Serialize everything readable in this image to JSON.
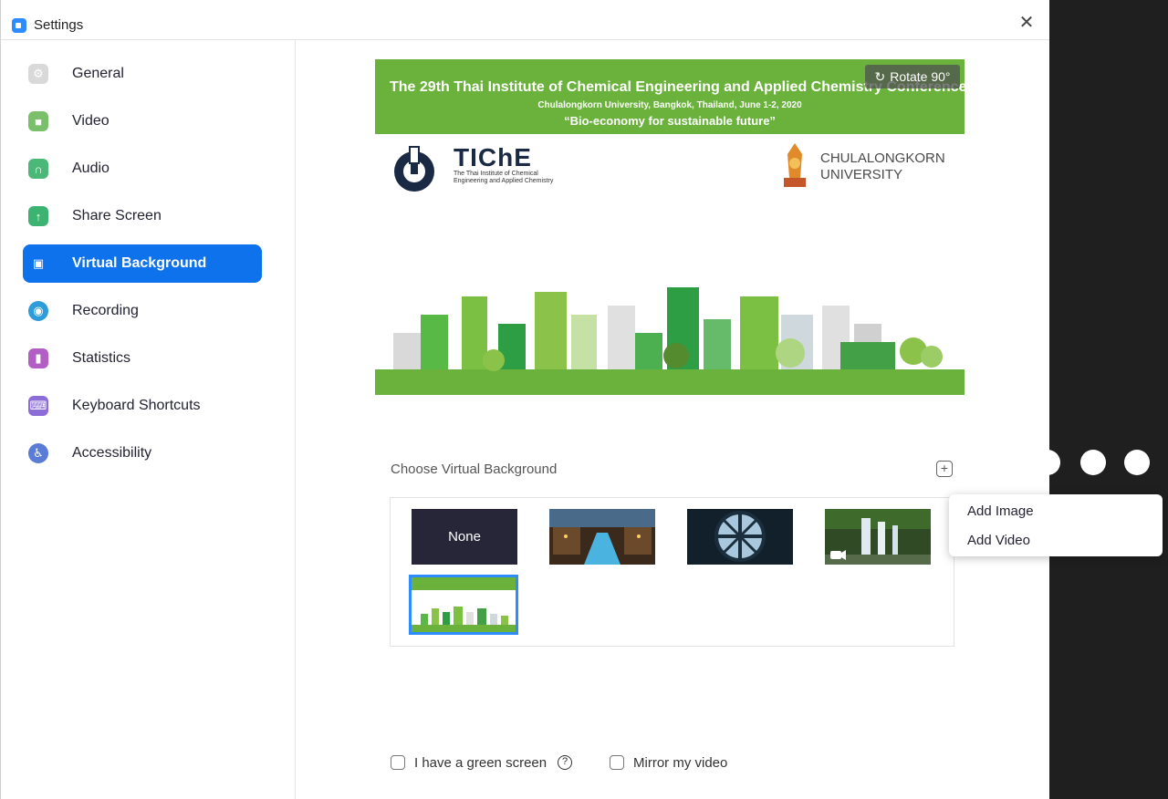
{
  "window": {
    "title": "Settings",
    "close_glyph": "✕"
  },
  "sidebar": {
    "items": [
      {
        "label": "General",
        "icon": "gear-icon",
        "color": "#d9d9d9",
        "glyph": "⚙"
      },
      {
        "label": "Video",
        "icon": "video-camera-icon",
        "color": "#7ac06a",
        "glyph": "■"
      },
      {
        "label": "Audio",
        "icon": "headphones-icon",
        "color": "#4cb878",
        "glyph": "∩"
      },
      {
        "label": "Share Screen",
        "icon": "share-screen-icon",
        "color": "#3cb371",
        "glyph": "↑"
      },
      {
        "label": "Virtual Background",
        "icon": "person-card-icon",
        "color": "#0e72ed",
        "glyph": "▣",
        "active": true
      },
      {
        "label": "Recording",
        "icon": "recording-icon",
        "color": "#2d9cdb",
        "glyph": "◉"
      },
      {
        "label": "Statistics",
        "icon": "bar-chart-icon",
        "color": "#b35ec4",
        "glyph": "▮"
      },
      {
        "label": "Keyboard Shortcuts",
        "icon": "keyboard-icon",
        "color": "#8c6cd6",
        "glyph": "⌨"
      },
      {
        "label": "Accessibility",
        "icon": "accessibility-icon",
        "color": "#5a7bd6",
        "glyph": "♿"
      }
    ]
  },
  "preview": {
    "banner_title": "The 29th Thai Institute of Chemical Engineering and Applied Chemistry Conference",
    "banner_sub": "Chulalongkorn University, Bangkok, Thailand, June 1-2, 2020",
    "banner_tagline": "“Bio-economy for sustainable future”",
    "rotate_label": "Rotate 90°",
    "tiche_title": "TIChE",
    "tiche_sub": "The Thai Institute of Chemical Engineering and Applied Chemistry",
    "cu_line1": "CHULALONGKORN",
    "cu_line2": "UNIVERSITY",
    "banner_color": "#6ab23b"
  },
  "choose": {
    "label": "Choose Virtual Background",
    "add_glyph": "+"
  },
  "thumbnails": {
    "none_label": "None"
  },
  "menu": {
    "items": [
      "Add Image",
      "Add Video"
    ]
  },
  "options": {
    "green_screen_label": "I have a green screen",
    "help_glyph": "?",
    "mirror_label": "Mirror my video"
  },
  "colors": {
    "accent": "#0e72ed",
    "selected_border": "#2d8cff"
  }
}
